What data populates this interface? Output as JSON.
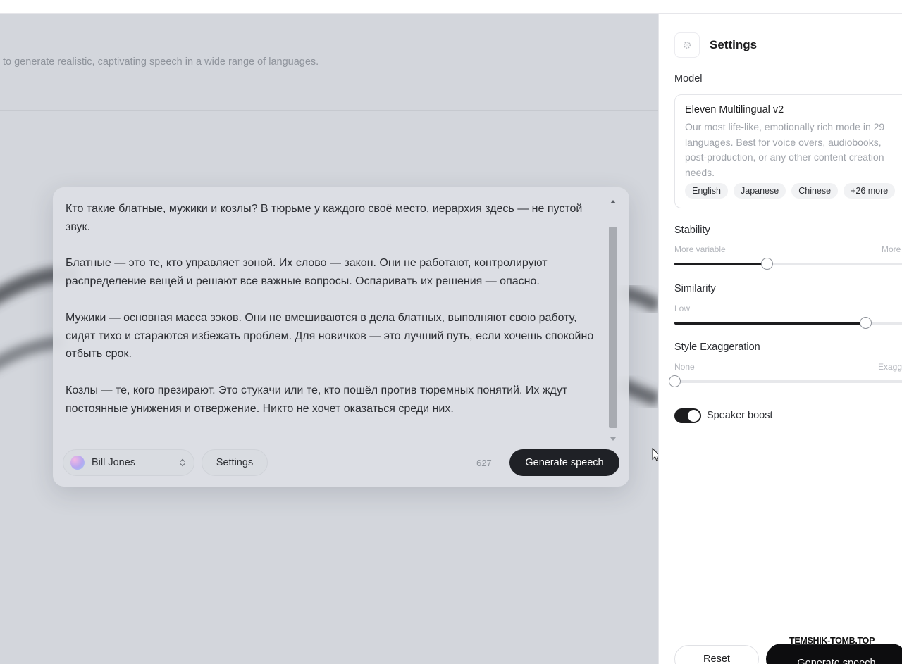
{
  "main": {
    "subtitle": "to generate realistic, captivating speech in a wide range of languages."
  },
  "editor": {
    "paragraphs": [
      "Кто такие блатные, мужики и козлы? В тюрьме у каждого своё место, иерархия здесь — не пустой звук.",
      "Блатные — это те, кто управляет зоной. Их слово — закон. Они не работают, контролируют распределение вещей и решают все важные вопросы. Оспаривать их решения — опасно.",
      "Мужики — основная масса зэков. Они не вмешиваются в дела блатных, выполняют свою работу, сидят тихо и стараются избежать проблем. Для новичков — это лучший путь, если хочешь спокойно отбыть срок.",
      "Козлы — те, кого презирают. Это стукачи или те, кто пошёл против тюремных понятий. Их ждут постоянные унижения и отвержение. Никто не хочет оказаться среди них."
    ],
    "voice_name": "Bill Jones",
    "settings_label": "Settings",
    "char_count": "627",
    "generate_label": "Generate speech"
  },
  "settings_panel": {
    "title": "Settings",
    "model_label": "Model",
    "model": {
      "name": "Eleven Multilingual v2",
      "description": "Our most life-like, emotionally rich mode in 29 languages. Best for voice overs, audiobooks, post-production, or any other content creation needs.",
      "tags": [
        "English",
        "Japanese",
        "Chinese",
        "+26 more"
      ]
    },
    "stability": {
      "label": "Stability",
      "min_label": "More variable",
      "max_label": "More",
      "value": 0.385
    },
    "similarity": {
      "label": "Similarity",
      "min_label": "Low",
      "value": 0.797
    },
    "style": {
      "label": "Style Exaggeration",
      "min_label": "None",
      "max_label": "Exagg",
      "value": 0.0
    },
    "speaker_boost": {
      "label": "Speaker boost",
      "enabled": true
    },
    "reset_label": "Reset",
    "generate_label": "Generate speech"
  },
  "watermark": "TEMSHIK-TOMB.TOP",
  "colors": {
    "background": "#d3d6dc",
    "accent": "#1d1d1f",
    "muted_text": "#9fa3aa"
  }
}
